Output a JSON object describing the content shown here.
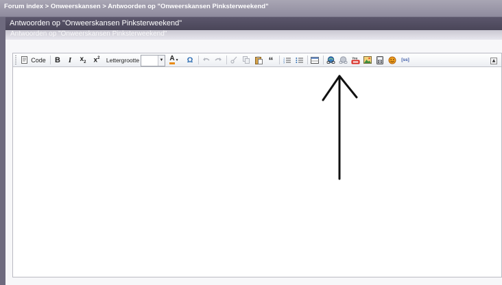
{
  "breadcrumb": {
    "path": "Forum index > Onweerskansen > Antwoorden op \"Onweerskansen Pinksterweekend\""
  },
  "panel": {
    "title": "Antwoorden op \"Onweerskansen Pinksterweekend\"",
    "subtitle": "Antwoorden op \"Onweerskansen Pinksterweekend\""
  },
  "toolbar": {
    "code_label": "Code",
    "bold_label": "B",
    "italic_label": "I",
    "subscript_label": "x",
    "subscript_mark": "2",
    "superscript_label": "x",
    "superscript_mark": "2",
    "font_size_label": "Lettergrootte",
    "font_size_value": "",
    "font_color_label": "A",
    "special_char_label": "Ω",
    "quote_label": "“",
    "embed_label": "[ss]",
    "youtube_label": "You"
  },
  "editor": {
    "content": ""
  },
  "colors": {
    "topbar": "#9a97a8",
    "panel_header": "#534e64",
    "accent_blue": "#2f6fb4",
    "arrow": "#111111"
  }
}
